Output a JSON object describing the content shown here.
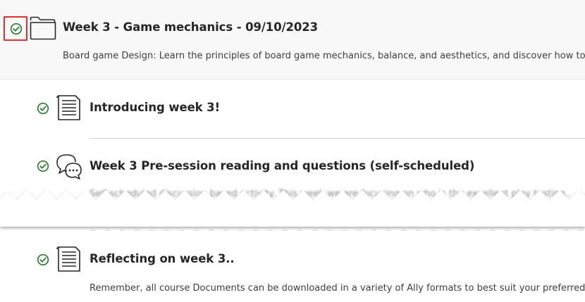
{
  "folder": {
    "title": "Week 3 - Game mechanics - 09/10/2023",
    "description": "Board game Design: Learn the principles of board game mechanics, balance, and aesthetics, and discover how to c",
    "status_icon": "check-circle-icon",
    "type_icon": "folder-icon"
  },
  "items": [
    {
      "title": "Introducing week 3!",
      "status_icon": "check-circle-icon",
      "type_icon": "document-icon"
    },
    {
      "title": "Week 3 Pre-session reading and questions (self-scheduled)",
      "description_partial": "Self-scheduled discussion based activity. This week we are focusing on who is the excellent play testing..",
      "status_icon": "check-circle-icon",
      "type_icon": "discussion-icon"
    },
    {
      "title": "Reflecting on week 3..",
      "description": "Remember, all course Documents can be downloaded in a variety of Ally formats to best suit your preferred",
      "status_icon": "check-circle-icon",
      "type_icon": "document-icon"
    }
  ],
  "colors": {
    "check_green": "#2e7d32",
    "highlight_red": "#e0312e",
    "folder_bg": "#f8f8f8"
  }
}
